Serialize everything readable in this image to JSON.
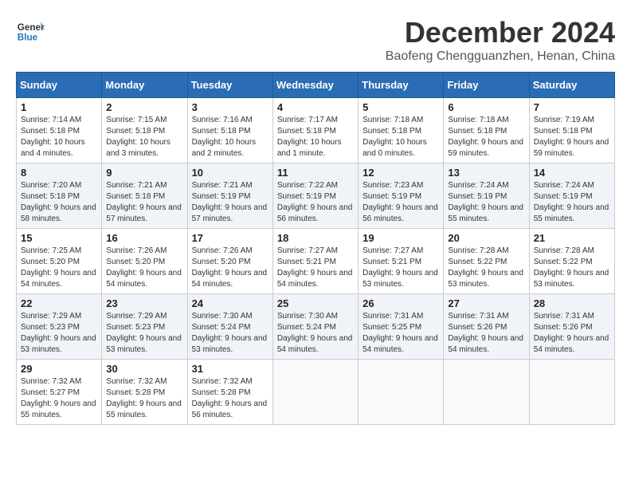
{
  "header": {
    "logo_line1": "General",
    "logo_line2": "Blue",
    "month": "December 2024",
    "location": "Baofeng Chengguanzhen, Henan, China"
  },
  "weekdays": [
    "Sunday",
    "Monday",
    "Tuesday",
    "Wednesday",
    "Thursday",
    "Friday",
    "Saturday"
  ],
  "weeks": [
    [
      {
        "day": "1",
        "sunrise": "7:14 AM",
        "sunset": "5:18 PM",
        "daylight": "10 hours and 4 minutes."
      },
      {
        "day": "2",
        "sunrise": "7:15 AM",
        "sunset": "5:18 PM",
        "daylight": "10 hours and 3 minutes."
      },
      {
        "day": "3",
        "sunrise": "7:16 AM",
        "sunset": "5:18 PM",
        "daylight": "10 hours and 2 minutes."
      },
      {
        "day": "4",
        "sunrise": "7:17 AM",
        "sunset": "5:18 PM",
        "daylight": "10 hours and 1 minute."
      },
      {
        "day": "5",
        "sunrise": "7:18 AM",
        "sunset": "5:18 PM",
        "daylight": "10 hours and 0 minutes."
      },
      {
        "day": "6",
        "sunrise": "7:18 AM",
        "sunset": "5:18 PM",
        "daylight": "9 hours and 59 minutes."
      },
      {
        "day": "7",
        "sunrise": "7:19 AM",
        "sunset": "5:18 PM",
        "daylight": "9 hours and 59 minutes."
      }
    ],
    [
      {
        "day": "8",
        "sunrise": "7:20 AM",
        "sunset": "5:18 PM",
        "daylight": "9 hours and 58 minutes."
      },
      {
        "day": "9",
        "sunrise": "7:21 AM",
        "sunset": "5:18 PM",
        "daylight": "9 hours and 57 minutes."
      },
      {
        "day": "10",
        "sunrise": "7:21 AM",
        "sunset": "5:19 PM",
        "daylight": "9 hours and 57 minutes."
      },
      {
        "day": "11",
        "sunrise": "7:22 AM",
        "sunset": "5:19 PM",
        "daylight": "9 hours and 56 minutes."
      },
      {
        "day": "12",
        "sunrise": "7:23 AM",
        "sunset": "5:19 PM",
        "daylight": "9 hours and 56 minutes."
      },
      {
        "day": "13",
        "sunrise": "7:24 AM",
        "sunset": "5:19 PM",
        "daylight": "9 hours and 55 minutes."
      },
      {
        "day": "14",
        "sunrise": "7:24 AM",
        "sunset": "5:19 PM",
        "daylight": "9 hours and 55 minutes."
      }
    ],
    [
      {
        "day": "15",
        "sunrise": "7:25 AM",
        "sunset": "5:20 PM",
        "daylight": "9 hours and 54 minutes."
      },
      {
        "day": "16",
        "sunrise": "7:26 AM",
        "sunset": "5:20 PM",
        "daylight": "9 hours and 54 minutes."
      },
      {
        "day": "17",
        "sunrise": "7:26 AM",
        "sunset": "5:20 PM",
        "daylight": "9 hours and 54 minutes."
      },
      {
        "day": "18",
        "sunrise": "7:27 AM",
        "sunset": "5:21 PM",
        "daylight": "9 hours and 54 minutes."
      },
      {
        "day": "19",
        "sunrise": "7:27 AM",
        "sunset": "5:21 PM",
        "daylight": "9 hours and 53 minutes."
      },
      {
        "day": "20",
        "sunrise": "7:28 AM",
        "sunset": "5:22 PM",
        "daylight": "9 hours and 53 minutes."
      },
      {
        "day": "21",
        "sunrise": "7:28 AM",
        "sunset": "5:22 PM",
        "daylight": "9 hours and 53 minutes."
      }
    ],
    [
      {
        "day": "22",
        "sunrise": "7:29 AM",
        "sunset": "5:23 PM",
        "daylight": "9 hours and 53 minutes."
      },
      {
        "day": "23",
        "sunrise": "7:29 AM",
        "sunset": "5:23 PM",
        "daylight": "9 hours and 53 minutes."
      },
      {
        "day": "24",
        "sunrise": "7:30 AM",
        "sunset": "5:24 PM",
        "daylight": "9 hours and 53 minutes."
      },
      {
        "day": "25",
        "sunrise": "7:30 AM",
        "sunset": "5:24 PM",
        "daylight": "9 hours and 54 minutes."
      },
      {
        "day": "26",
        "sunrise": "7:31 AM",
        "sunset": "5:25 PM",
        "daylight": "9 hours and 54 minutes."
      },
      {
        "day": "27",
        "sunrise": "7:31 AM",
        "sunset": "5:26 PM",
        "daylight": "9 hours and 54 minutes."
      },
      {
        "day": "28",
        "sunrise": "7:31 AM",
        "sunset": "5:26 PM",
        "daylight": "9 hours and 54 minutes."
      }
    ],
    [
      {
        "day": "29",
        "sunrise": "7:32 AM",
        "sunset": "5:27 PM",
        "daylight": "9 hours and 55 minutes."
      },
      {
        "day": "30",
        "sunrise": "7:32 AM",
        "sunset": "5:28 PM",
        "daylight": "9 hours and 55 minutes."
      },
      {
        "day": "31",
        "sunrise": "7:32 AM",
        "sunset": "5:28 PM",
        "daylight": "9 hours and 56 minutes."
      },
      null,
      null,
      null,
      null
    ]
  ]
}
